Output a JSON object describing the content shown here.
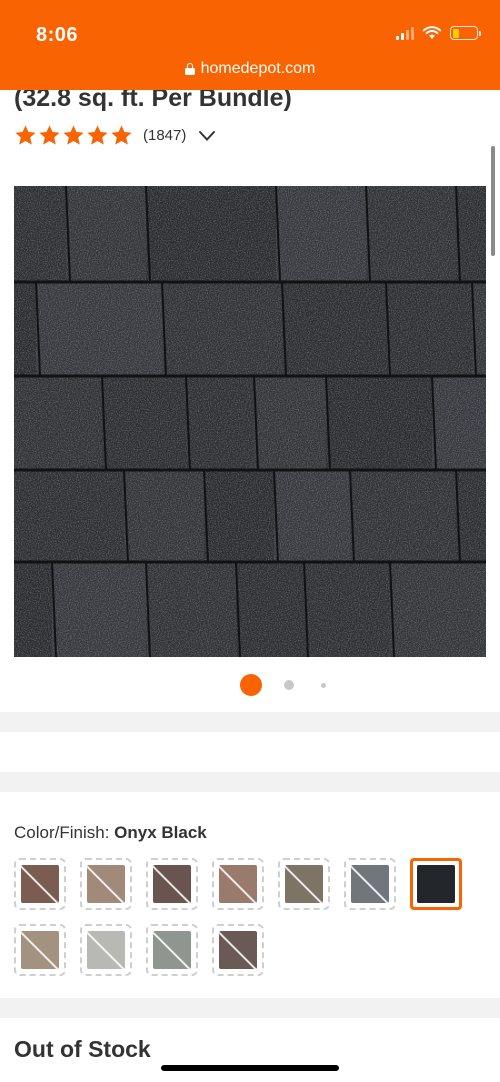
{
  "status_bar": {
    "time": "8:06",
    "battery_color": "#ffcc00"
  },
  "url_bar": {
    "domain": "homedepot.com"
  },
  "product": {
    "title_partial": "(32.8 sq. ft. Per Bundle)",
    "rating": {
      "stars": 5,
      "count": "(1847)"
    }
  },
  "carousel": {
    "total": 3,
    "active": 1
  },
  "color_finish": {
    "label": "Color/Finish:",
    "selected": "Onyx Black",
    "swatches": [
      {
        "color": "#7a5c50",
        "available": false
      },
      {
        "color": "#a18a7a",
        "available": false
      },
      {
        "color": "#6a5450",
        "available": false
      },
      {
        "color": "#9a7a6c",
        "available": false
      },
      {
        "color": "#7d7466",
        "available": false
      },
      {
        "color": "#70767c",
        "available": false
      },
      {
        "color": "#23262b",
        "available": true,
        "selected": true
      },
      {
        "color": "#a49280",
        "available": false
      },
      {
        "color": "#b8b8b4",
        "available": false
      },
      {
        "color": "#8f9690",
        "available": false
      },
      {
        "color": "#6a5a56",
        "available": false
      }
    ]
  },
  "availability": {
    "heading": "Out of Stock"
  },
  "colors": {
    "brand_orange": "#f96302"
  }
}
